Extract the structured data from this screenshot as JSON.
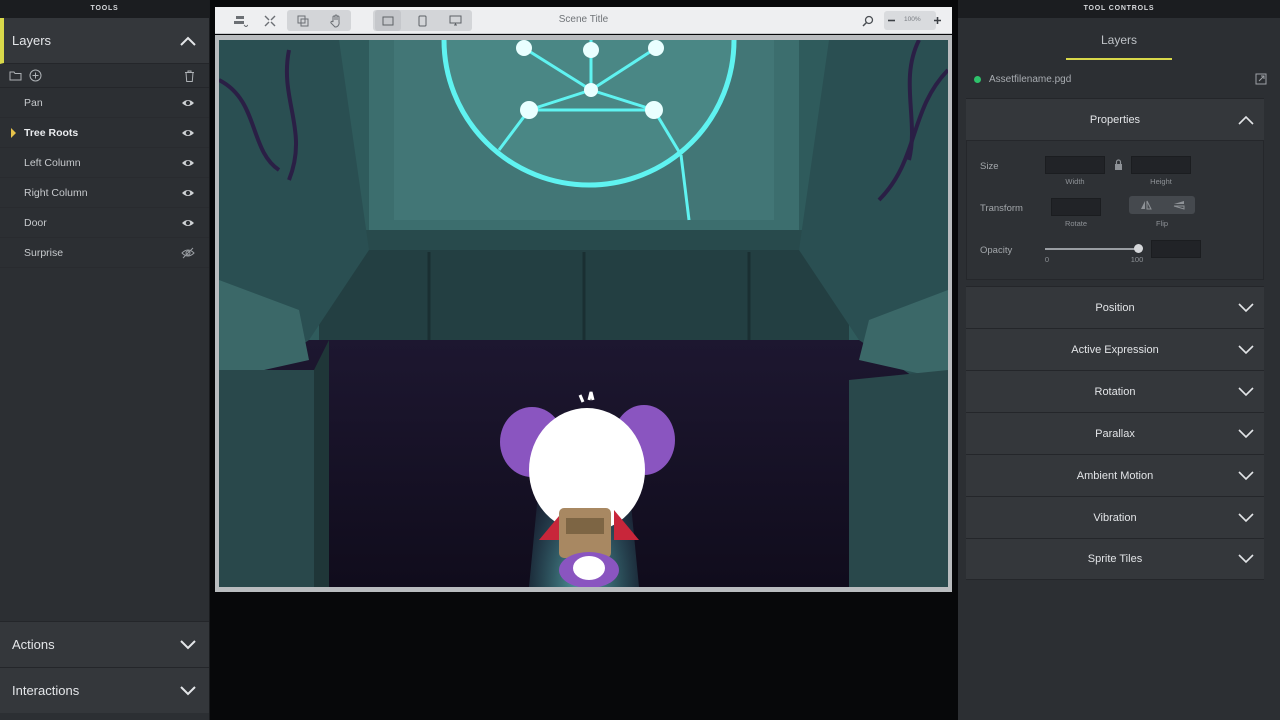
{
  "left_panel": {
    "header": "TOOLS",
    "layers": {
      "title": "Layers",
      "items": [
        {
          "label": "Pan",
          "visible": true,
          "active": false
        },
        {
          "label": "Tree Roots",
          "visible": true,
          "active": true
        },
        {
          "label": "Left Column",
          "visible": true,
          "active": false
        },
        {
          "label": "Right Column",
          "visible": true,
          "active": false
        },
        {
          "label": "Door",
          "visible": true,
          "active": false
        },
        {
          "label": "Surprise",
          "visible": false,
          "active": false
        }
      ]
    },
    "bottom": [
      {
        "label": "Actions"
      },
      {
        "label": "Interactions"
      }
    ]
  },
  "toolbar": {
    "scene_title": "Scene Title",
    "zoom": "100%",
    "icons": [
      "align-icon",
      "fit-screen-icon",
      "layers-copy-icon",
      "hand-pan-icon",
      "frame-landscape-icon",
      "device-phone-icon",
      "device-desktop-icon",
      "search-icon",
      "zoom-out-icon",
      "zoom-in-icon"
    ]
  },
  "right_panel": {
    "header": "TOOL CONTROLS",
    "tab": "Layers",
    "asset": {
      "filename": "Assetfilename.pgd",
      "status_color": "#2ec26b"
    },
    "properties": {
      "title": "Properties",
      "size_label": "Size",
      "width_label": "Width",
      "height_label": "Height",
      "transform_label": "Transform",
      "rotate_label": "Rotate",
      "flip_label": "Flip",
      "opacity_label": "Opacity",
      "opacity_min": "0",
      "opacity_max": "100",
      "opacity_value": 1.0
    },
    "sections": [
      {
        "label": "Position"
      },
      {
        "label": "Active Expression"
      },
      {
        "label": "Rotation"
      },
      {
        "label": "Parallax"
      },
      {
        "label": "Ambient Motion"
      },
      {
        "label": "Vibration"
      },
      {
        "label": "Sprite Tiles"
      }
    ]
  },
  "colors": {
    "accent": "#d8d84a",
    "glow": "#4ff0f0",
    "character": "#8a55c0"
  }
}
